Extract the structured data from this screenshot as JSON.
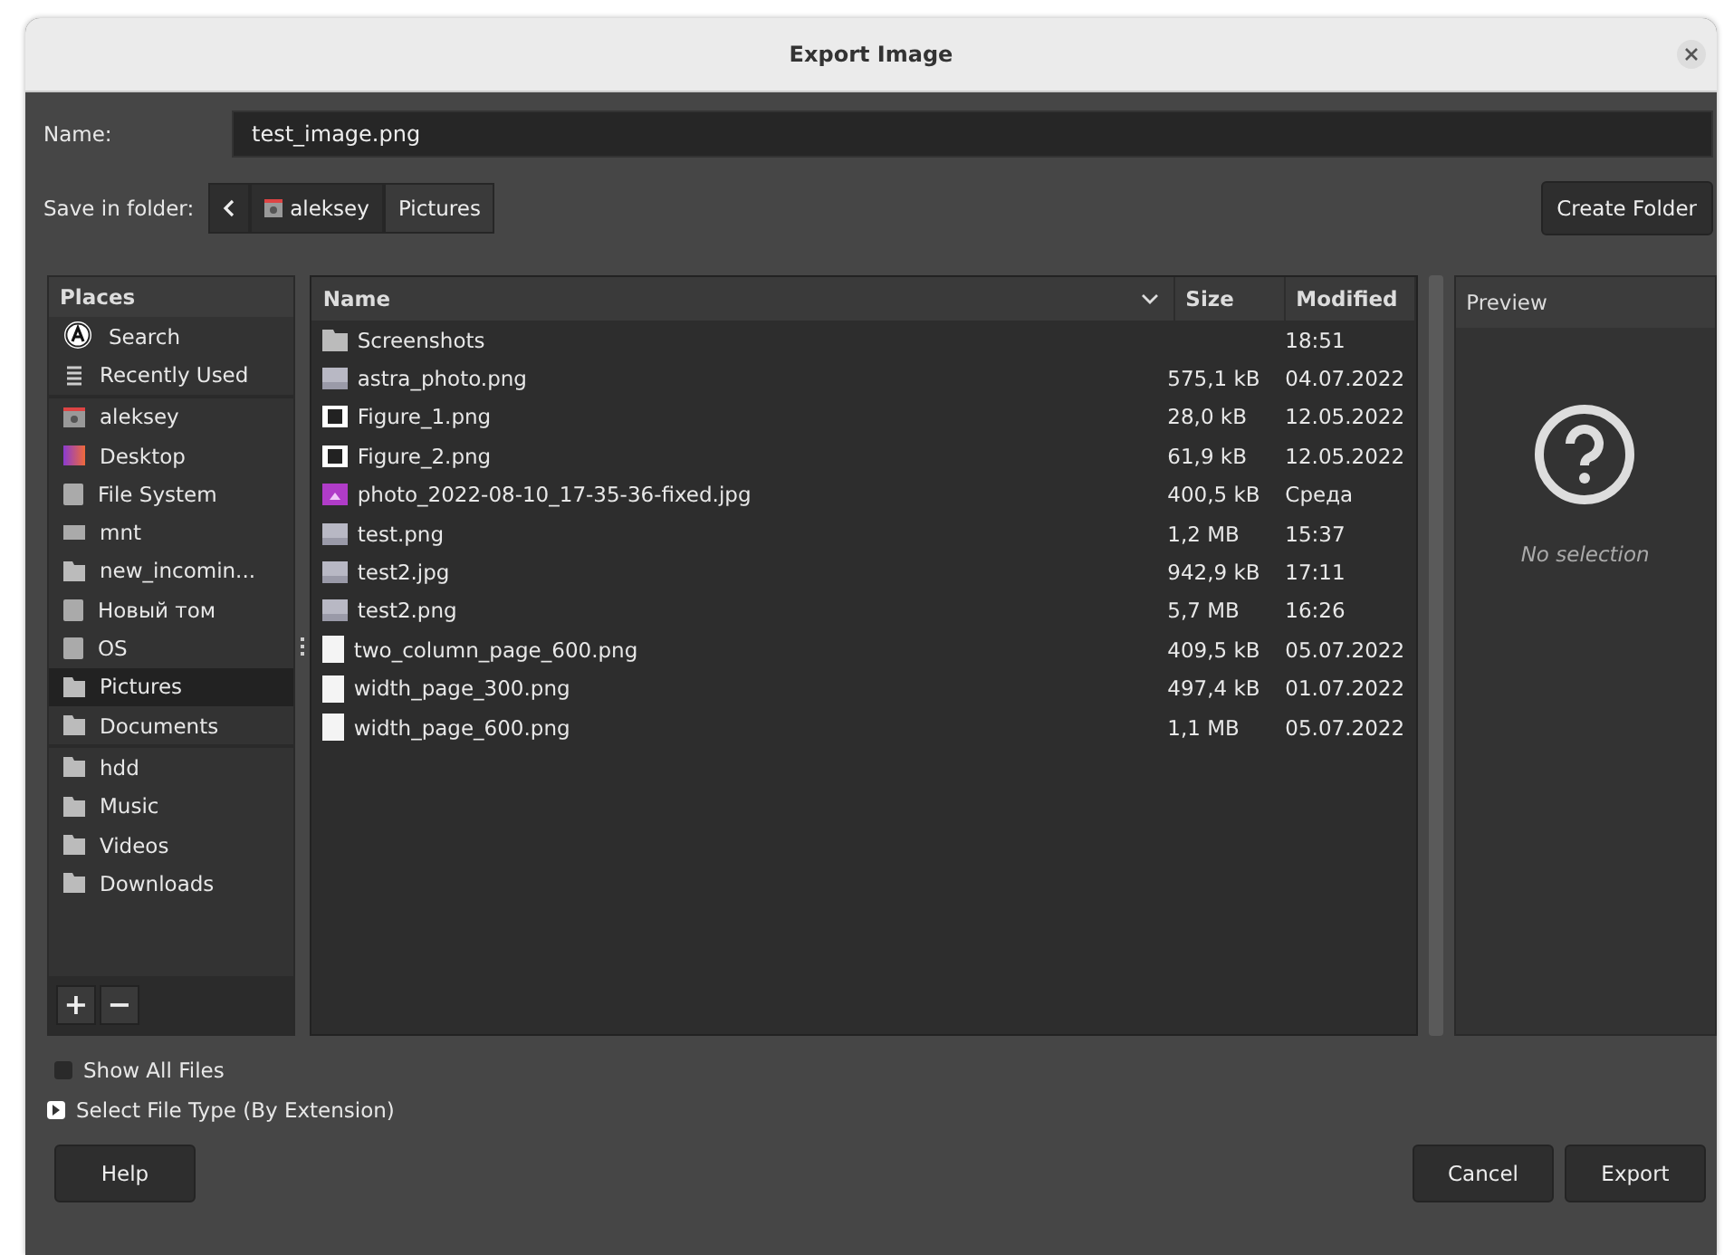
{
  "window": {
    "title": "Export Image"
  },
  "name_field": {
    "label": "Name:",
    "value": "test_image.png"
  },
  "folder_bar": {
    "label": "Save in folder:",
    "crumbs": [
      {
        "label": "aleksey",
        "kind": "home",
        "selected": false
      },
      {
        "label": "Pictures",
        "kind": "folder",
        "selected": true
      }
    ],
    "create_button": "Create Folder"
  },
  "places": {
    "title": "Places",
    "groups": [
      [
        {
          "label": "Search",
          "kind": "search",
          "selected": false
        },
        {
          "label": "Recently Used",
          "kind": "recent",
          "selected": false
        }
      ],
      [
        {
          "label": "aleksey",
          "kind": "home",
          "selected": false
        },
        {
          "label": "Desktop",
          "kind": "desktop",
          "selected": false
        },
        {
          "label": "File System",
          "kind": "drive",
          "selected": false
        },
        {
          "label": "mnt",
          "kind": "disk",
          "selected": false
        },
        {
          "label": "new_incomin...",
          "kind": "folder",
          "selected": false
        },
        {
          "label": "Новый том",
          "kind": "drive",
          "selected": false
        },
        {
          "label": "OS",
          "kind": "drive",
          "selected": false
        },
        {
          "label": "Pictures",
          "kind": "folder",
          "selected": true
        },
        {
          "label": "Documents",
          "kind": "folder",
          "selected": false
        }
      ],
      [
        {
          "label": "hdd",
          "kind": "folder",
          "selected": false
        },
        {
          "label": "Music",
          "kind": "folder",
          "selected": false
        },
        {
          "label": "Videos",
          "kind": "folder",
          "selected": false
        },
        {
          "label": "Downloads",
          "kind": "folder",
          "selected": false
        }
      ]
    ],
    "add_button": "+",
    "remove_button": "−"
  },
  "files": {
    "columns": [
      "Name",
      "Size",
      "Modified"
    ],
    "rows": [
      {
        "name": "Screenshots",
        "kind": "folder",
        "modified": "18:51"
      },
      {
        "name": "astra_photo.png",
        "kind": "image",
        "size": "575,1 kB",
        "modified": "04.07.2022"
      },
      {
        "name": "Figure_1.png",
        "kind": "figure",
        "size": "28,0 kB",
        "modified": "12.05.2022"
      },
      {
        "name": "Figure_2.png",
        "kind": "figure",
        "size": "61,9 kB",
        "modified": "12.05.2022"
      },
      {
        "name": "photo_2022-08-10_17-35-36-fixed.jpg",
        "kind": "photo",
        "size": "400,5 kB",
        "modified": "Среда"
      },
      {
        "name": "test.png",
        "kind": "image",
        "size": "1,2 MB",
        "modified": "15:37"
      },
      {
        "name": "test2.jpg",
        "kind": "image",
        "size": "942,9 kB",
        "modified": "17:11"
      },
      {
        "name": "test2.png",
        "kind": "image",
        "size": "5,7 MB",
        "modified": "16:26"
      },
      {
        "name": "two_column_page_600.png",
        "kind": "page",
        "size": "409,5 kB",
        "modified": "05.07.2022"
      },
      {
        "name": "width_page_300.png",
        "kind": "page",
        "size": "497,4 kB",
        "modified": "01.07.2022"
      },
      {
        "name": "width_page_600.png",
        "kind": "page",
        "size": "1,1 MB",
        "modified": "05.07.2022"
      }
    ]
  },
  "preview": {
    "title": "Preview",
    "message": "No selection"
  },
  "show_all_files": {
    "label": "Show All Files",
    "checked": false
  },
  "file_type": {
    "label": "Select File Type (By Extension)",
    "expanded": false
  },
  "buttons": {
    "help": "Help",
    "cancel": "Cancel",
    "export": "Export"
  }
}
